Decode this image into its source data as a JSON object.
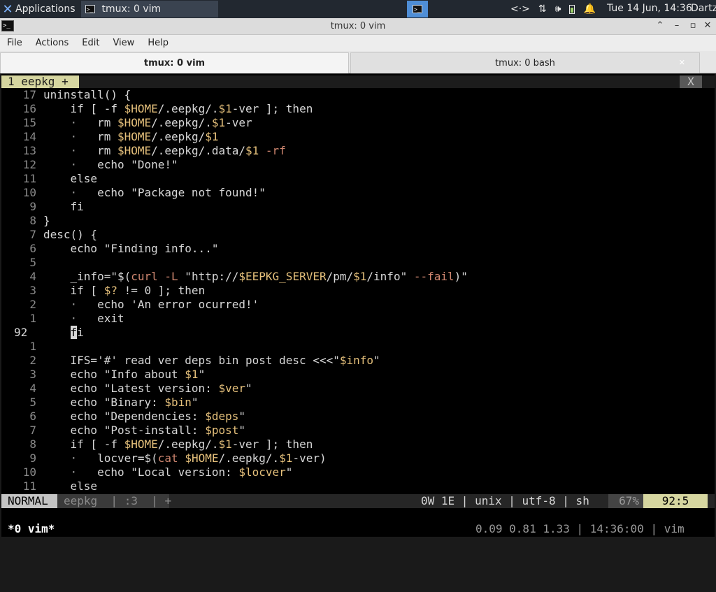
{
  "panel": {
    "applications": "Applications",
    "task_title": "tmux: 0 vim",
    "clock": "Tue 14 Jun, 14:36",
    "user": "Dartz",
    "tray_icons": [
      "network-arrows-icon",
      "network-updown-icon",
      "volume-icon",
      "battery-icon",
      "bell-icon"
    ]
  },
  "window": {
    "title": "tmux: 0 vim"
  },
  "menu": {
    "file": "File",
    "actions": "Actions",
    "edit": "Edit",
    "view": "View",
    "help": "Help"
  },
  "tabs": [
    {
      "label": "tmux: 0 vim"
    },
    {
      "label": "tmux: 0 bash"
    }
  ],
  "vim": {
    "buffer_tab": "1 eepkg +",
    "buffer_close": "X",
    "lines": [
      {
        "n": "17",
        "t": "uninstall() {"
      },
      {
        "n": "16",
        "t": "    if [ -f $HOME/.eepkg/.$1-ver ]; then"
      },
      {
        "n": "15",
        "t": "    ·   rm $HOME/.eepkg/.$1-ver"
      },
      {
        "n": "14",
        "t": "    ·   rm $HOME/.eepkg/$1"
      },
      {
        "n": "13",
        "t": "    ·   rm $HOME/.eepkg/.data/$1 -rf"
      },
      {
        "n": "12",
        "t": "    ·   echo \"Done!\""
      },
      {
        "n": "11",
        "t": "    else"
      },
      {
        "n": "10",
        "t": "    ·   echo \"Package not found!\""
      },
      {
        "n": "9",
        "t": "    fi"
      },
      {
        "n": "8",
        "t": "}"
      },
      {
        "n": "7",
        "t": "desc() {"
      },
      {
        "n": "6",
        "t": "    echo \"Finding info...\""
      },
      {
        "n": "5",
        "t": ""
      },
      {
        "n": "4",
        "t": "    _info=\"$(curl -L \"http://$EEPKG_SERVER/pm/$1/info\" --fail)\""
      },
      {
        "n": "3",
        "t": "    if [ $? != 0 ]; then"
      },
      {
        "n": "2",
        "t": "    ·   echo 'An error ocurred!'"
      },
      {
        "n": "1",
        "t": "    ·   exit"
      },
      {
        "n": "92",
        "t": "    fi",
        "current": true
      },
      {
        "n": "1",
        "t": ""
      },
      {
        "n": "2",
        "t": "    IFS='#' read ver deps bin post desc <<<\"$info\""
      },
      {
        "n": "3",
        "t": "    echo \"Info about $1\""
      },
      {
        "n": "4",
        "t": "    echo \"Latest version: $ver\""
      },
      {
        "n": "5",
        "t": "    echo \"Binary: $bin\""
      },
      {
        "n": "6",
        "t": "    echo \"Dependencies: $deps\""
      },
      {
        "n": "7",
        "t": "    echo \"Post-install: $post\""
      },
      {
        "n": "8",
        "t": "    if [ -f $HOME/.eepkg/.$1-ver ]; then"
      },
      {
        "n": "9",
        "t": "    ·   locver=$(cat $HOME/.eepkg/.$1-ver)"
      },
      {
        "n": "10",
        "t": "    ·   echo \"Local version: $locver\""
      },
      {
        "n": "11",
        "t": "    else"
      }
    ],
    "status": {
      "mode": "NORMAL",
      "file": "eepkg  | :3  | +",
      "info": "0W 1E | unix | utf-8 | sh",
      "percent": "67%",
      "position": "92:5"
    }
  },
  "tmux": {
    "left": "*0 vim*",
    "right": "0.09 0.81 1.33 | 14:36:00 | vim"
  }
}
